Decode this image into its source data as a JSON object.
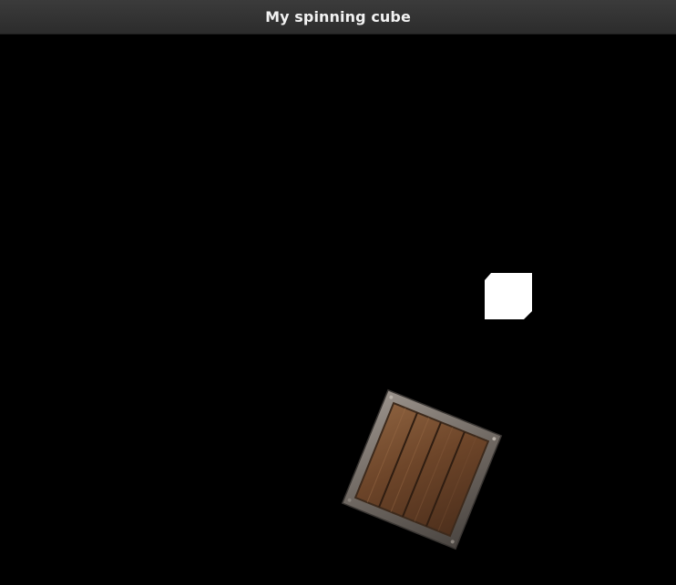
{
  "window": {
    "title": "My spinning cube"
  },
  "scene": {
    "background_color": "#000000",
    "light_cube_color": "#ffffff",
    "crate_wood_color": "#7a5236",
    "crate_frame_color": "#7d7570"
  }
}
